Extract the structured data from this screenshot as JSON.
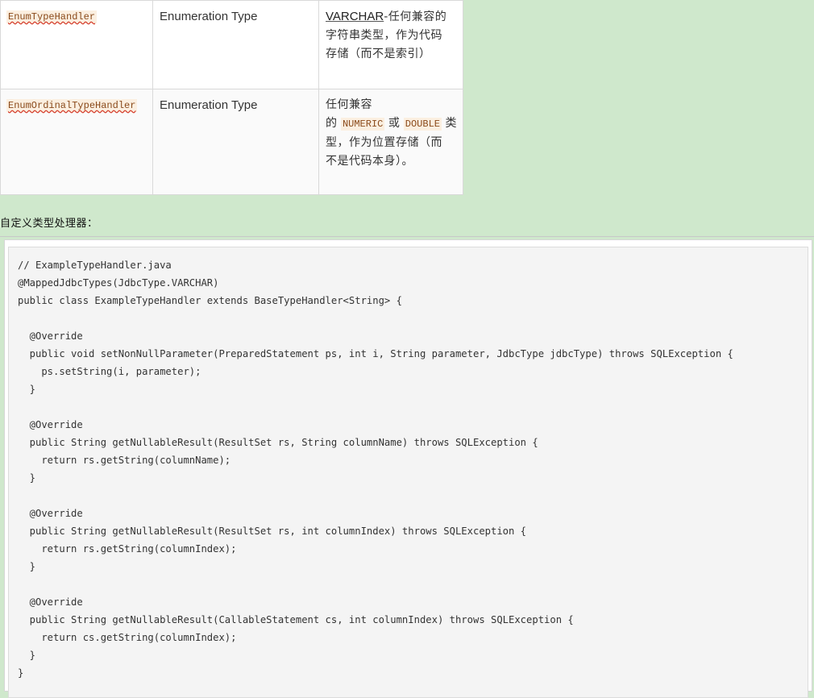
{
  "table": {
    "rows": [
      {
        "handler": "EnumTypeHandler",
        "java_type": "Enumeration Type",
        "jdbc_lead": "VARCHAR",
        "jdbc_line1_rest": "-任何兼容的",
        "jdbc_line2": "字符串类型，作为代码",
        "jdbc_line3": "存储（而不是索引）"
      },
      {
        "handler": "EnumOrdinalTypeHandler",
        "java_type": "Enumeration Type",
        "jdbc_line1": "任何兼容",
        "jdbc_line2_prefix": "的",
        "jdbc_code1": "NUMERIC",
        "jdbc_or": "或",
        "jdbc_code2": "DOUBLE",
        "jdbc_line2_suffix": "类",
        "jdbc_line3": "型，作为位置存储（而",
        "jdbc_line4": "不是代码本身）。"
      }
    ]
  },
  "section_label": "自定义类型处理器：",
  "code_lines": [
    "// ExampleTypeHandler.java",
    "@MappedJdbcTypes(JdbcType.VARCHAR)",
    "public class ExampleTypeHandler extends BaseTypeHandler<String> {",
    "",
    "  @Override",
    "  public void setNonNullParameter(PreparedStatement ps, int i, String parameter, JdbcType jdbcType) throws SQLException {",
    "    ps.setString(i, parameter);",
    "  }",
    "",
    "  @Override",
    "  public String getNullableResult(ResultSet rs, String columnName) throws SQLException {",
    "    return rs.getString(columnName);",
    "  }",
    "",
    "  @Override",
    "  public String getNullableResult(ResultSet rs, int columnIndex) throws SQLException {",
    "    return rs.getString(columnIndex);",
    "  }",
    "",
    "  @Override",
    "  public String getNullableResult(CallableStatement cs, int columnIndex) throws SQLException {",
    "    return cs.getString(columnIndex);",
    "  }",
    "}"
  ]
}
